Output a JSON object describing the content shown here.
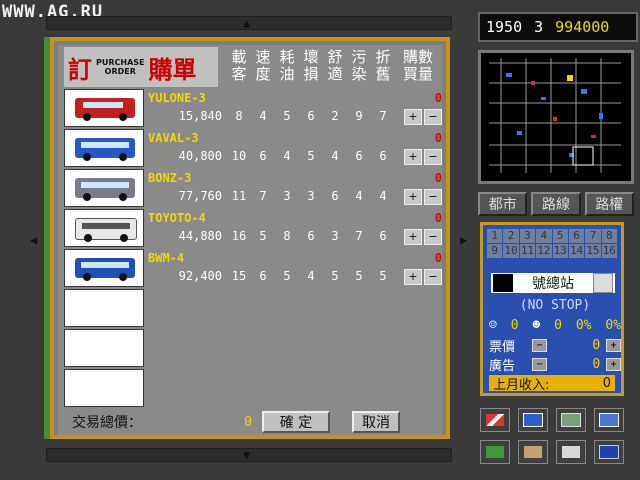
{
  "watermark": "WWW.AG.RU",
  "header": {
    "year": "1950",
    "month": "3",
    "money": "994000"
  },
  "side_tabs": [
    "都市",
    "路線",
    "路權"
  ],
  "station_panel": {
    "slots": [
      "1",
      "2",
      "3",
      "4",
      "5",
      "6",
      "7",
      "8",
      "9",
      "10",
      "11",
      "12",
      "13",
      "14",
      "15",
      "16"
    ],
    "station_name": "號總站",
    "no_stop": "(NO STOP)",
    "counts": {
      "a": "0",
      "b": "0",
      "c": "0%",
      "d": "0%"
    },
    "fare_label": "票價",
    "fare_value": "0",
    "ad_label": "廣告",
    "ad_value": "0",
    "income_label": "上月收入:",
    "income_value": "0"
  },
  "order": {
    "title_left": "訂",
    "title_mid1": "PURCHASE",
    "title_mid2": "ORDER",
    "title_right": "購單",
    "col_headers": [
      "載客",
      "速度",
      "耗油",
      "壞損",
      "舒適",
      "污染",
      "折舊",
      "購數買量"
    ],
    "footer_label": "交易總價：",
    "footer_total": "0",
    "confirm": "確 定",
    "cancel": "取消",
    "items": [
      {
        "name": "YULONE-3",
        "price": "15,840",
        "stats": [
          "8",
          "4",
          "5",
          "6",
          "2",
          "9",
          "7"
        ],
        "qty": "0",
        "color": "#c42020"
      },
      {
        "name": "VAVAL-3",
        "price": "40,800",
        "stats": [
          "10",
          "6",
          "4",
          "5",
          "4",
          "6",
          "6"
        ],
        "qty": "0",
        "color": "#2458c8"
      },
      {
        "name": "BONZ-3",
        "price": "77,760",
        "stats": [
          "11",
          "7",
          "3",
          "3",
          "6",
          "4",
          "4"
        ],
        "qty": "0",
        "color": "#7a7a8a"
      },
      {
        "name": "TOYOTO-4",
        "price": "44,880",
        "stats": [
          "16",
          "5",
          "8",
          "6",
          "3",
          "7",
          "6"
        ],
        "qty": "0",
        "color": "#e8e8e8"
      },
      {
        "name": "BWM-4",
        "price": "92,400",
        "stats": [
          "15",
          "6",
          "5",
          "4",
          "5",
          "5",
          "5"
        ],
        "qty": "0",
        "color": "#1e50b8"
      }
    ]
  },
  "tools": [
    "crane-icon",
    "bus-route-icon",
    "building-icon",
    "depot-icon",
    "money-icon",
    "people-icon",
    "office-icon",
    "disk-icon"
  ]
}
